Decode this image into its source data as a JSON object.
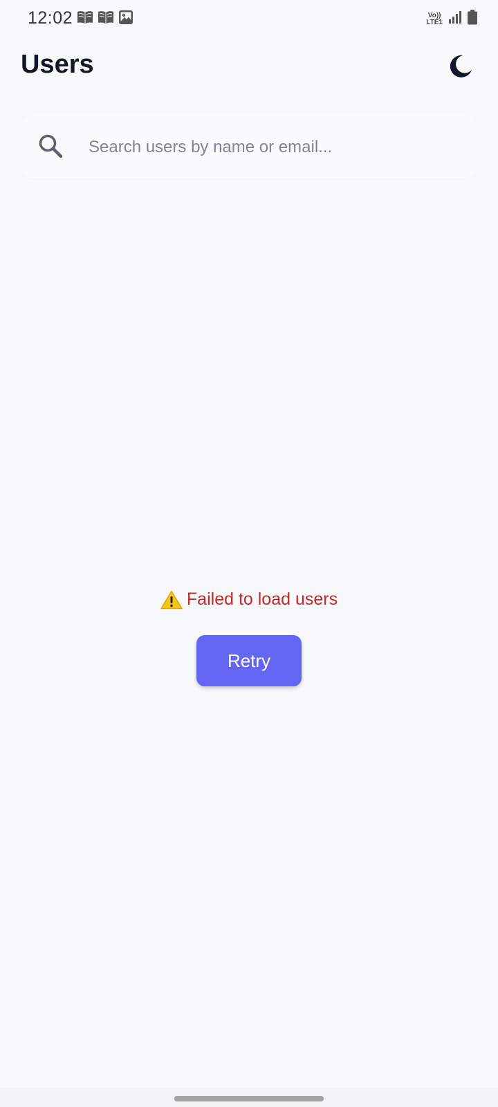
{
  "status_bar": {
    "time": "12:02",
    "left_icons": [
      "book-icon",
      "book-icon",
      "image-icon"
    ],
    "network_label_top": "Vo))",
    "network_label_bottom": "LTE1",
    "right_icons": [
      "signal-icon",
      "battery-icon"
    ]
  },
  "header": {
    "title": "Users",
    "theme_toggle_icon": "moon-icon"
  },
  "search": {
    "icon": "search-icon",
    "placeholder": "Search users by name or email...",
    "value": ""
  },
  "error": {
    "icon": "warning-icon",
    "message": "Failed to load users",
    "color": "#c62828"
  },
  "retry": {
    "label": "Retry",
    "color": "#6366f1"
  },
  "colors": {
    "background": "#f7f8fa",
    "title": "#111827",
    "accent": "#6366f1",
    "error": "#c62828"
  }
}
